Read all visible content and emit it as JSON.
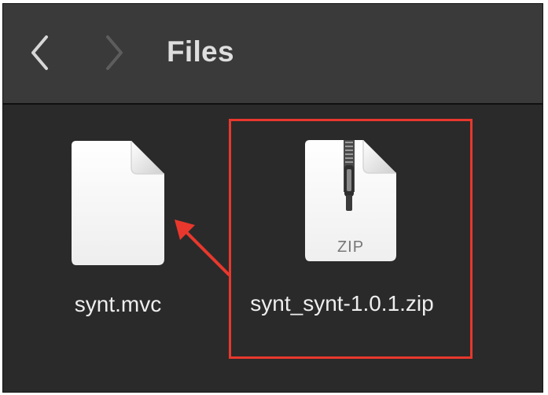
{
  "window": {
    "title": "Files"
  },
  "toolbar": {
    "back_icon": "chevron-left-icon",
    "forward_icon": "chevron-right-icon"
  },
  "files": [
    {
      "name": "synt.mvc",
      "icon": "document-icon"
    },
    {
      "name": "synt_synt-1.0.1.zip",
      "icon": "zip-archive-icon",
      "type_label": "ZIP",
      "highlighted": true
    }
  ],
  "annotations": {
    "highlight_color": "#e8382d",
    "arrow_color": "#e8382d"
  },
  "colors": {
    "toolbar_bg": "#3a3a3a",
    "content_bg": "#2a2a2a",
    "text": "#eeeeee"
  }
}
